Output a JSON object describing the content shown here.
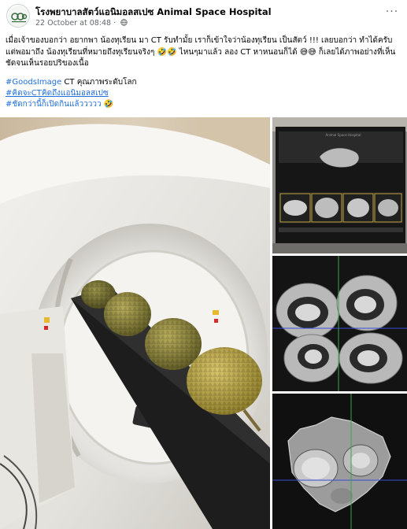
{
  "post": {
    "page_name": "โรงพยาบาลสัตว์แอนิมอลสเปซ Animal Space Hospital",
    "timestamp": "22 October at 08:48",
    "separator": "·",
    "more_label": "···",
    "text": "เมื่อเจ้าของบอกว่า อยากพา น้องทุเรียน มา CT รับทำมั้ย เราก็เข้าใจว่าน้องทุเรียน เป็นสัตว์ !!! เลยบอกว่า ทำได้ครับ  แต่พอมาถึง น้องทุเรียนที่หมายถึงทุเรียนจริงๆ 🤣🤣  ไหนๆมาแล้ว ลอง CT หาหนอนก็ได้ 😅😅 ก็เลยได้ภาพอย่างที่เห็น ชัดจนเห็นรอยปริของเนื้อ",
    "hashtags": {
      "tag1": "#GoodsImage",
      "tag1_suffix": " CT คุณภาพระดับโลก",
      "tag2": "#คิดจะCTคิดถึงแอนิมอลสเปซ",
      "tag3": "#ชัดกว่านี้ก็เปิดกินแล้ววววว",
      "tag3_emoji": "🤣"
    }
  },
  "screen_text": {
    "monitor_title": "Animal Space Hospital"
  },
  "icons": {
    "avatar": "hospital-logo",
    "globe": "globe-icon",
    "more": "more-options-icon"
  }
}
